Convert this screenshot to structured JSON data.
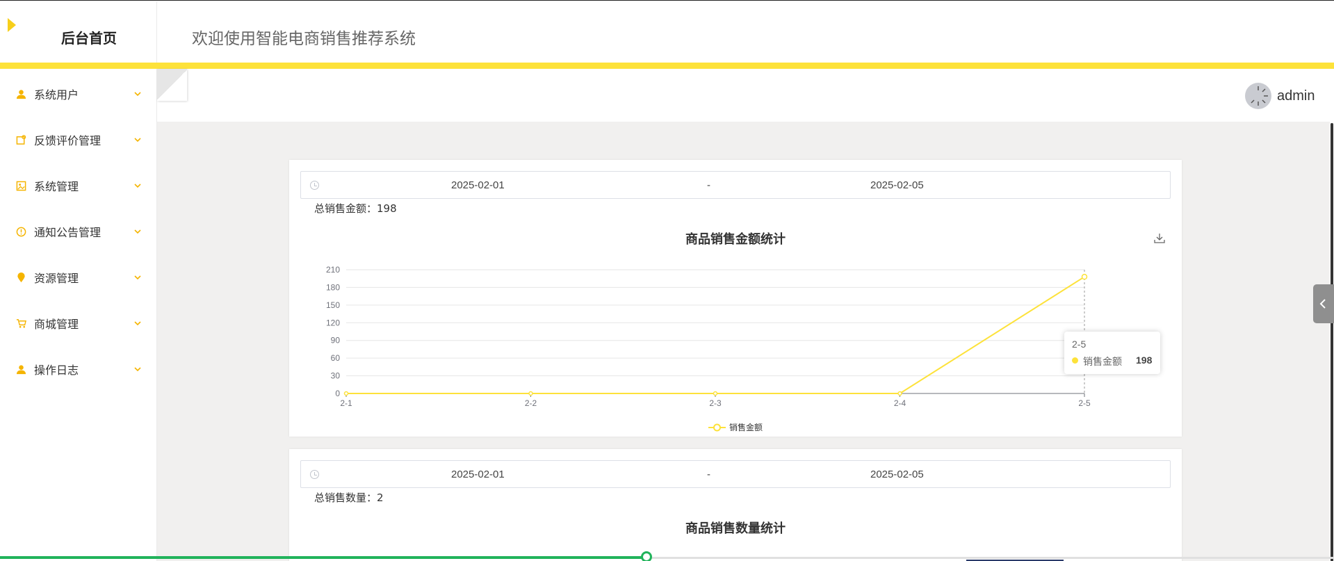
{
  "header": {
    "brand": "后台首页",
    "welcome": "欢迎使用智能电商销售推荐系统"
  },
  "sidebar": {
    "items": [
      {
        "label": "系统用户",
        "icon": "user-icon"
      },
      {
        "label": "反馈评价管理",
        "icon": "feedback-icon"
      },
      {
        "label": "系统管理",
        "icon": "image-icon"
      },
      {
        "label": "通知公告管理",
        "icon": "info-icon"
      },
      {
        "label": "资源管理",
        "icon": "location-icon"
      },
      {
        "label": "商城管理",
        "icon": "cart-icon"
      },
      {
        "label": "操作日志",
        "icon": "user-icon"
      }
    ]
  },
  "user": {
    "name": "admin"
  },
  "colors": {
    "accent": "#fde23a",
    "icon": "#f5b400",
    "progress": "#21b35b"
  },
  "card1": {
    "date_start": "2025-02-01",
    "date_sep": "-",
    "date_end": "2025-02-05",
    "total": "总销售金额：198",
    "title": "商品销售金额统计"
  },
  "card2": {
    "date_start": "2025-02-01",
    "date_sep": "-",
    "date_end": "2025-02-05",
    "total": "总销售数量：2",
    "title": "商品销售数量统计"
  },
  "tooltip": {
    "title": "2-5",
    "series": "销售金额",
    "value": "198"
  },
  "chart_data": {
    "type": "line",
    "title": "商品销售金额统计",
    "categories": [
      "2-1",
      "2-2",
      "2-3",
      "2-4",
      "2-5"
    ],
    "series": [
      {
        "name": "销售金额",
        "values": [
          0,
          0,
          0,
          0,
          198
        ]
      }
    ],
    "ylim": [
      0,
      210
    ],
    "yticks": [
      0,
      30,
      60,
      90,
      120,
      150,
      180,
      210
    ],
    "grid": true,
    "legend": "bottom-center"
  }
}
